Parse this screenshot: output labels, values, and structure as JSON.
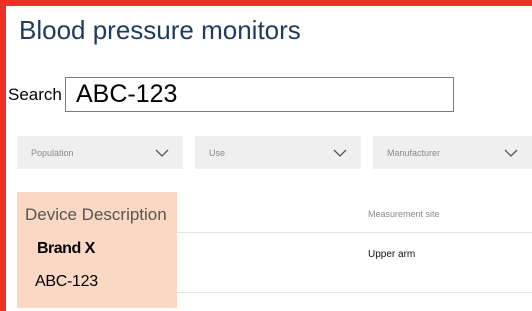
{
  "colors": {
    "accent": "#ed3124",
    "title": "#1f3b5c",
    "highlight": "#fad8c4",
    "filter_bg": "#efefef"
  },
  "page": {
    "title": "Blood pressure monitors"
  },
  "search": {
    "label": "Search",
    "value": "ABC-123"
  },
  "filters": [
    {
      "label": "Population",
      "icon": "chevron-down-icon"
    },
    {
      "label": "Use",
      "icon": "chevron-down-icon"
    },
    {
      "label": "Manufacturer",
      "icon": "chevron-down-icon"
    }
  ],
  "table": {
    "columns": {
      "description": "Device Description",
      "measurement_site": "Measurement site"
    },
    "rows": [
      {
        "brand": "Brand X",
        "model": "ABC-123",
        "measurement_site": "Upper arm"
      }
    ]
  }
}
